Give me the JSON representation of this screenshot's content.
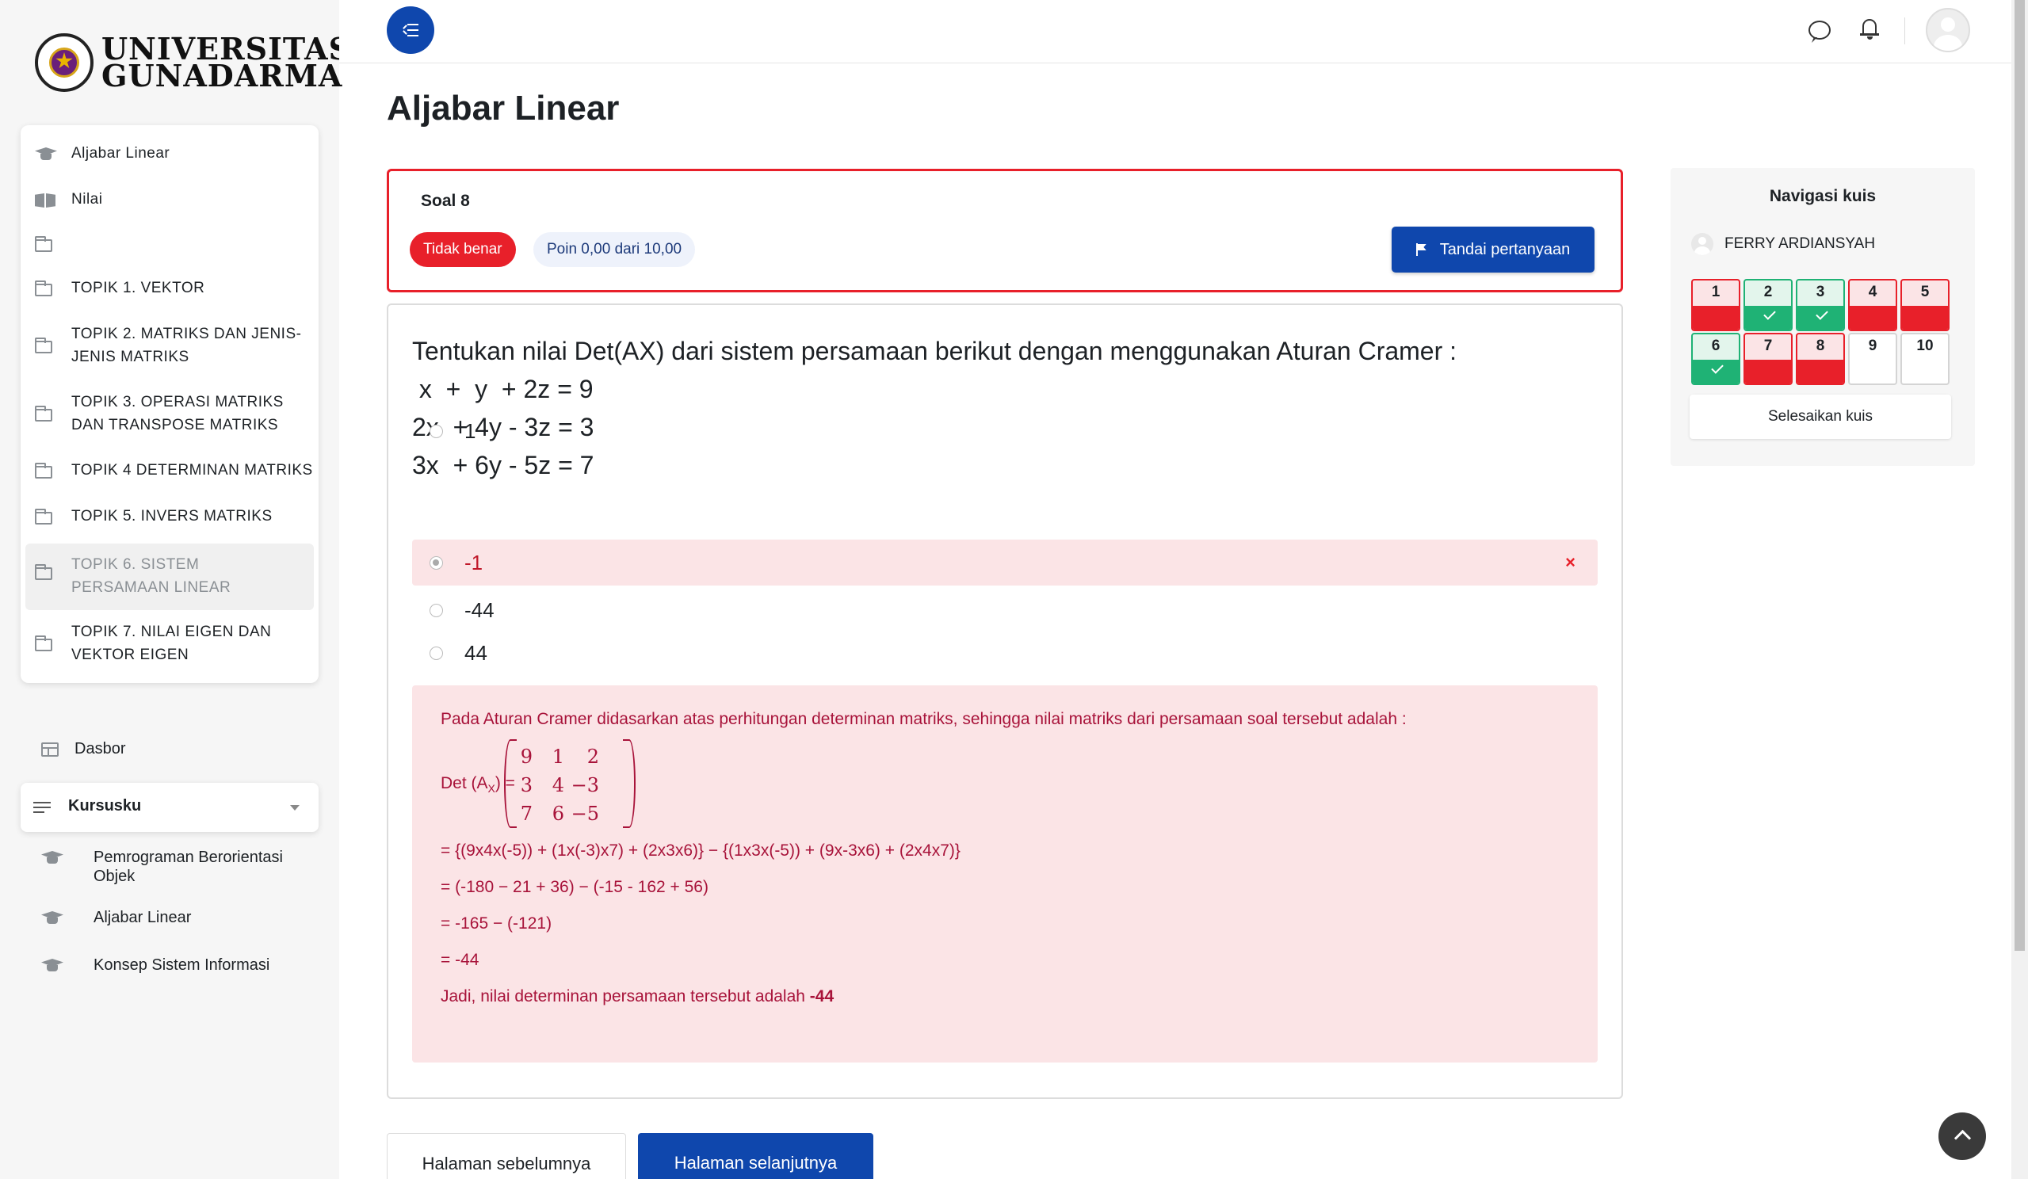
{
  "logo": {
    "line1": "UNIVERSITAS",
    "line2": "GUNADARMA"
  },
  "course_nav": {
    "items": [
      {
        "label": "Aljabar Linear",
        "icon": "graduation-cap-icon"
      },
      {
        "label": "Nilai",
        "icon": "book-icon"
      },
      {
        "label": "",
        "icon": "folder-icon"
      },
      {
        "label": "TOPIK 1. VEKTOR",
        "icon": "folder-icon"
      },
      {
        "label": "TOPIK 2. MATRIKS DAN JENIS-JENIS MATRIKS",
        "icon": "folder-icon"
      },
      {
        "label": "TOPIK 3. OPERASI MATRIKS DAN TRANSPOSE MATRIKS",
        "icon": "folder-icon"
      },
      {
        "label": "TOPIK 4 DETERMINAN MATRIKS",
        "icon": "folder-icon"
      },
      {
        "label": "TOPIK 5. INVERS MATRIKS",
        "icon": "folder-icon"
      },
      {
        "label": "TOPIK 6. SISTEM PERSAMAAN LINEAR",
        "icon": "folder-icon",
        "active": true
      },
      {
        "label": "TOPIK 7. NILAI EIGEN DAN VEKTOR EIGEN",
        "icon": "folder-icon"
      }
    ]
  },
  "sidebar": {
    "dashboard_label": "Dasbor",
    "my_courses_label": "Kursusku",
    "courses": [
      {
        "label": "Pemrograman Berorientasi Objek"
      },
      {
        "label": "Aljabar Linear"
      },
      {
        "label": "Konsep Sistem Informasi"
      }
    ]
  },
  "page": {
    "title": "Aljabar Linear"
  },
  "question": {
    "number_label": "Soal 8",
    "status_badge": "Tidak benar",
    "points_badge": "Poin 0,00 dari 10,00",
    "flag_button": "Tandai pertanyaan",
    "prompt": "Tentukan nilai Det(AX) dari sistem persamaan berikut dengan menggunakan Aturan Cramer :",
    "equations": [
      " x  +  y  + 2z = 9",
      "2x  + 4y - 3z = 3",
      "3x  + 6y - 5z = 7"
    ],
    "options": [
      {
        "value": "1",
        "selected": false
      },
      {
        "value": "-1",
        "selected": true,
        "incorrect": true
      },
      {
        "value": "-44",
        "selected": false
      },
      {
        "value": "44",
        "selected": false
      }
    ],
    "wrong_mark": "×"
  },
  "feedback": {
    "intro": "Pada Aturan Cramer didasarkan atas perhitungan determinan matriks, sehingga nilai matriks dari persamaan soal tersebut adalah :",
    "det_label_pre": "Det (A",
    "det_label_sub": "X",
    "det_label_post": ") =",
    "matrix": [
      [
        "9",
        "1",
        "2"
      ],
      [
        "3",
        "4",
        "−3"
      ],
      [
        "7",
        "6",
        "−5"
      ]
    ],
    "steps": [
      "= {(9x4x(-5)) + (1x(-3)x7) + (2x3x6)} − {(1x3x(-5)) + (9x-3x6) + (2x4x7)}",
      "= (-180 − 21 + 36) − (-15 - 162 + 56)",
      "= -165 − (-121)",
      "= -44"
    ],
    "conclusion": "Jadi, nilai determinan persamaan tersebut adalah ",
    "answer": "-44"
  },
  "quiz_nav": {
    "title": "Navigasi kuis",
    "user_name": "FERRY ARDIANSYAH",
    "questions": [
      {
        "n": "1",
        "state": "incorrect"
      },
      {
        "n": "2",
        "state": "correct"
      },
      {
        "n": "3",
        "state": "correct"
      },
      {
        "n": "4",
        "state": "incorrect"
      },
      {
        "n": "5",
        "state": "incorrect"
      },
      {
        "n": "6",
        "state": "correct"
      },
      {
        "n": "7",
        "state": "incorrect"
      },
      {
        "n": "8",
        "state": "incorrect"
      },
      {
        "n": "9",
        "state": "none"
      },
      {
        "n": "10",
        "state": "none"
      }
    ],
    "finish_label": "Selesaikan kuis"
  },
  "footer_nav": {
    "prev_label": "Halaman sebelumnya",
    "next_label": "Halaman selanjutnya"
  },
  "colors": {
    "brand_blue": "#0f47ad",
    "incorrect_red": "#e8202a",
    "correct_green": "#1fb275",
    "feedback_bg": "#fbe4e6"
  }
}
